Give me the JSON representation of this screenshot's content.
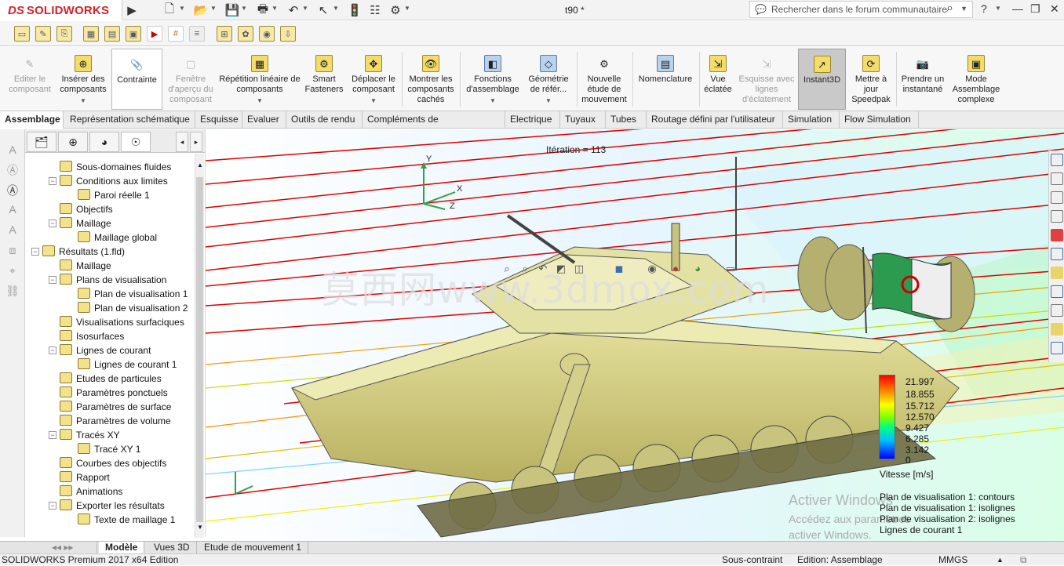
{
  "titlebar": {
    "logo_ds": "DS",
    "logo_text": "SOLIDWORKS",
    "doc_title": "t90 *",
    "search_placeholder": "Rechercher dans le forum communautaire",
    "help_label": "?"
  },
  "ribbon": {
    "buttons": [
      {
        "label": "Editer le composant",
        "disabled": true
      },
      {
        "label": "Insérer des composants"
      },
      {
        "label": "Contrainte"
      },
      {
        "label": "Fenêtre d'aperçu du composant",
        "disabled": true
      },
      {
        "label": "Répétition linéaire de composants"
      },
      {
        "label": "Smart Fasteners"
      },
      {
        "label": "Déplacer le composant"
      },
      {
        "label": "Montrer les composants cachés"
      },
      {
        "label": "Fonctions d'assemblage"
      },
      {
        "label": "Géométrie de référ..."
      },
      {
        "label": "Nouvelle étude de mouvement"
      },
      {
        "label": "Nomenclature"
      },
      {
        "label": "Vue éclatée"
      },
      {
        "label": "Esquisse avec lignes d'éclatement",
        "disabled": true
      },
      {
        "label": "Instant3D",
        "selected": true
      },
      {
        "label": "Mettre à jour Speedpak"
      },
      {
        "label": "Prendre un instantané"
      },
      {
        "label": "Mode Assemblage complexe"
      }
    ]
  },
  "tabs": [
    "Assemblage",
    "Représentation schématique",
    "Esquisse",
    "Evaluer",
    "Outils de rendu",
    "Compléments de SOLIDWORKS",
    "Electrique",
    "Tuyaux",
    "Tubes",
    "Routage défini par l'utilisateur",
    "Simulation",
    "Flow Simulation"
  ],
  "tree": [
    {
      "label": "Sous-domaines fluides"
    },
    {
      "label": "Conditions aux limites"
    },
    {
      "label": "Paroi réelle 1"
    },
    {
      "label": "Objectifs"
    },
    {
      "label": "Maillage"
    },
    {
      "label": "Maillage global"
    },
    {
      "label": "Résultats (1.fld)"
    },
    {
      "label": "Maillage"
    },
    {
      "label": "Plans de visualisation"
    },
    {
      "label": "Plan de visualisation 1"
    },
    {
      "label": "Plan de visualisation 2"
    },
    {
      "label": "Visualisations surfaciques"
    },
    {
      "label": "Isosurfaces"
    },
    {
      "label": "Lignes de courant"
    },
    {
      "label": "Lignes de courant 1"
    },
    {
      "label": "Etudes de particules"
    },
    {
      "label": "Paramètres ponctuels"
    },
    {
      "label": "Paramètres de surface"
    },
    {
      "label": "Paramètres de volume"
    },
    {
      "label": "Tracés XY"
    },
    {
      "label": "Tracé XY 1"
    },
    {
      "label": "Courbes des objectifs"
    },
    {
      "label": "Rapport"
    },
    {
      "label": "Animations"
    },
    {
      "label": "Exporter les résultats"
    },
    {
      "label": "Texte de maillage 1"
    }
  ],
  "viewport": {
    "iteration": "Itération = 113",
    "watermark": "莫西网www.3dmox.com",
    "axis_x": "X",
    "axis_y": "Y",
    "axis_z": "Z",
    "legend": {
      "values": [
        "21.997",
        "18.855",
        "15.712",
        "12.570",
        "9.427",
        "6.285",
        "3.142",
        "0"
      ],
      "title": "Vitesse [m/s]",
      "labels": [
        "Plan de visualisation 1: contours",
        "Plan de visualisation 1: isolignes",
        "Plan de visualisation 2: isolignes",
        "Lignes de courant 1"
      ]
    },
    "activate_title": "Activer Windows",
    "activate_sub1": "Accédez aux paramètres",
    "activate_sub2": "activer Windows."
  },
  "bottom_tabs": [
    "Modèle",
    "Vues 3D",
    "Etude de mouvement 1"
  ],
  "status": {
    "edition": "SOLIDWORKS Premium 2017 x64 Edition",
    "constraint": "Sous-contraint",
    "editing": "Edition: Assemblage",
    "units": "MMGS"
  }
}
